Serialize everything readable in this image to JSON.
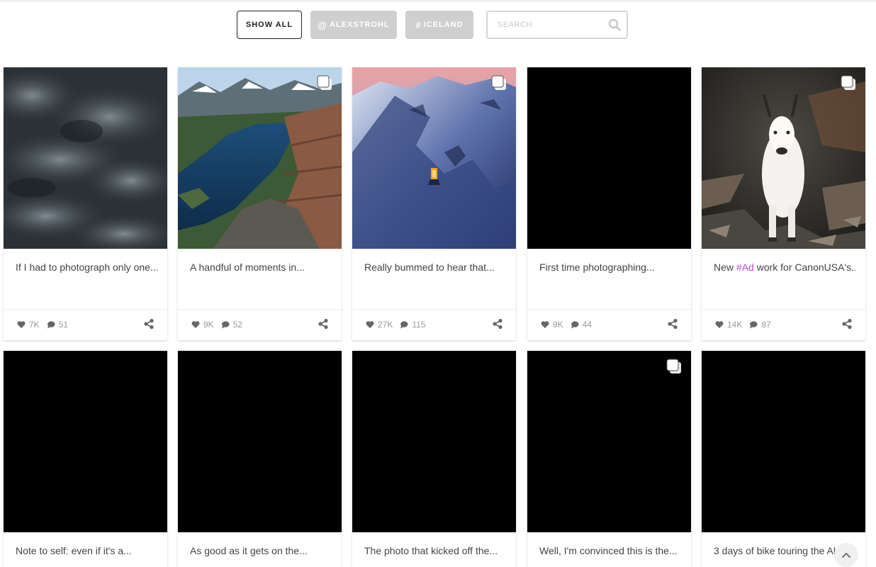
{
  "filters": {
    "show_all": "SHOW ALL",
    "user_prefix": "@",
    "user": "ALEXSTROHL",
    "tag_prefix": "#",
    "tag": "ICELAND",
    "search_placeholder": "SEARCH"
  },
  "colors": {
    "hashtag": "#c248d8",
    "inactive_filter": "#cfcfcf"
  },
  "posts": [
    {
      "caption": "If I had to photograph only one...",
      "likes": "7K",
      "comments": "51",
      "image": "storm-clouds",
      "multi": false
    },
    {
      "caption": "A handful of moments in...",
      "likes": "9K",
      "comments": "52",
      "image": "mountain-lake",
      "multi": true
    },
    {
      "caption": "Really bummed to hear that...",
      "likes": "27K",
      "comments": "115",
      "image": "snowy-mountain-hut",
      "multi": true
    },
    {
      "caption": "First time photographing...",
      "likes": "9K",
      "comments": "44",
      "image": "black",
      "multi": false
    },
    {
      "caption_before": "New ",
      "caption_hashtag": "#Ad",
      "caption_after": " work for CanonUSA's...",
      "likes": "14K",
      "comments": "87",
      "image": "mountain-goat",
      "multi": true
    },
    {
      "caption": "Note to self: even if it's a...",
      "image": "black",
      "multi": false
    },
    {
      "caption": "As good as it gets on the...",
      "image": "black",
      "multi": false
    },
    {
      "caption": "The photo that kicked off the...",
      "image": "black",
      "multi": false
    },
    {
      "caption": "Well, I'm convinced this is the...",
      "image": "black",
      "multi": true
    },
    {
      "caption": "3 days of bike touring the Alps",
      "image": "black",
      "multi": false
    }
  ]
}
